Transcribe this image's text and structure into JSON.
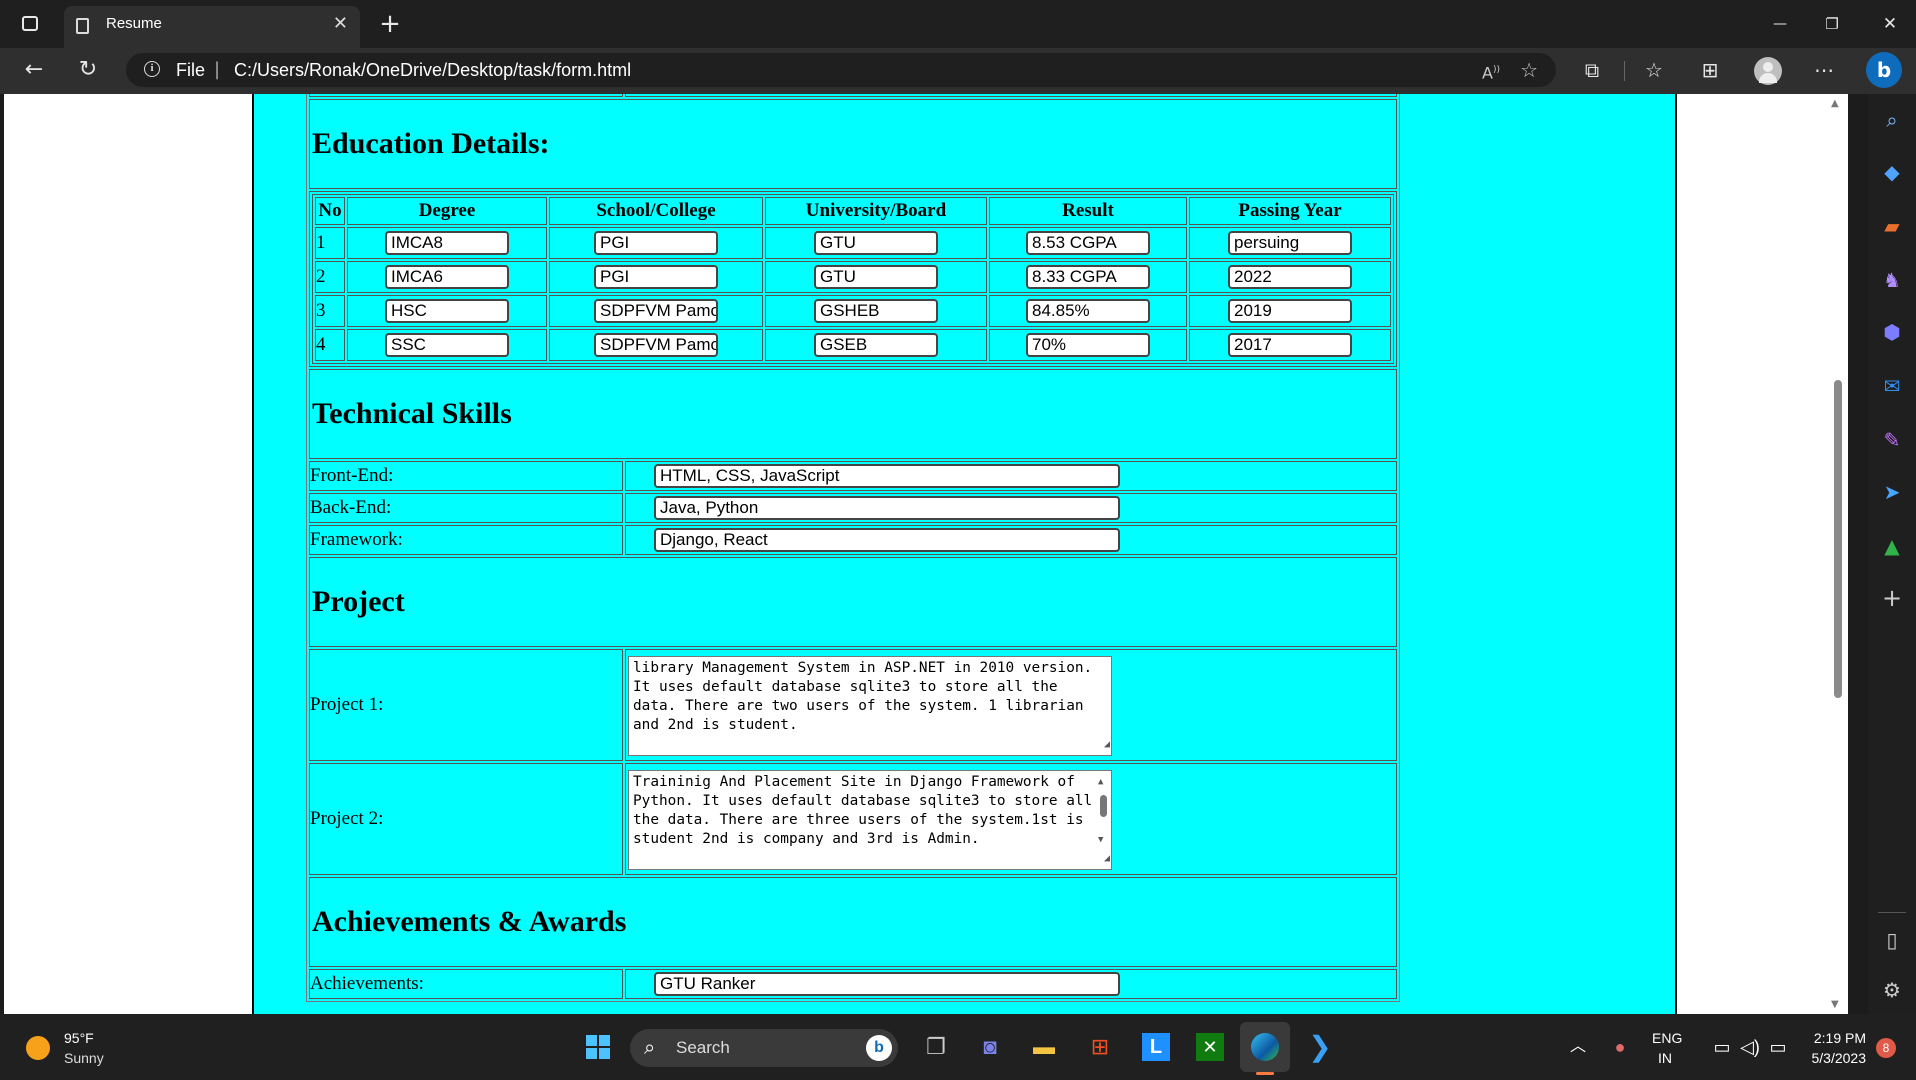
{
  "browser": {
    "tab_title": "Resume",
    "url_scheme": "File",
    "url": "C:/Users/Ronak/OneDrive/Desktop/task/form.html",
    "new_tab": "+",
    "window_minimize": "—",
    "window_restore": "❐",
    "window_close": "✕"
  },
  "education": {
    "heading": "Education Details:",
    "columns": [
      "No",
      "Degree",
      "School/College",
      "University/Board",
      "Result",
      "Passing Year"
    ],
    "rows": [
      {
        "no": "1",
        "degree": "IMCA8",
        "school": "PGI",
        "board": "GTU",
        "result": "8.53 CGPA",
        "year": "persuing"
      },
      {
        "no": "2",
        "degree": "IMCA6",
        "school": "PGI",
        "board": "GTU",
        "result": "8.33 CGPA",
        "year": "2022"
      },
      {
        "no": "3",
        "degree": "HSC",
        "school": "SDPFVM Pamol",
        "board": "GSHEB",
        "result": "84.85%",
        "year": "2019"
      },
      {
        "no": "4",
        "degree": "SSC",
        "school": "SDPFVM Pamol",
        "board": "GSEB",
        "result": "70%",
        "year": "2017"
      }
    ]
  },
  "skills": {
    "heading": "Technical Skills",
    "frontend_label": "Front-End:",
    "frontend_value": "HTML, CSS, JavaScript",
    "backend_label": "Back-End:",
    "backend_value": "Java, Python",
    "framework_label": "Framework:",
    "framework_value": "Django, React"
  },
  "project": {
    "heading": "Project",
    "p1_label": "Project 1:",
    "p1_value": "library Management System in ASP.NET in 2010 version. It uses default database sqlite3 to store all the data. There are two users of the system. 1 librarian and 2nd is student.",
    "p2_label": "Project 2:",
    "p2_value": "Traininig And Placement Site in Django Framework of Python. It uses default database sqlite3 to store all the data. There are three users of the system.1st is student 2nd is company and 3rd is Admin."
  },
  "achievements": {
    "heading": "Achievements & Awards",
    "label": "Achievements:",
    "value": "GTU Ranker"
  },
  "taskbar": {
    "weather_temp": "95°F",
    "weather_desc": "Sunny",
    "search_label": "Search",
    "lang_top": "ENG",
    "lang_bottom": "IN",
    "time": "2:19 PM",
    "date": "5/3/2023",
    "notification_count": "8"
  },
  "colors": {
    "page_panel": "#00ffff",
    "chrome_dark": "#1f1f1f",
    "edge_accent": "#0078d4"
  }
}
